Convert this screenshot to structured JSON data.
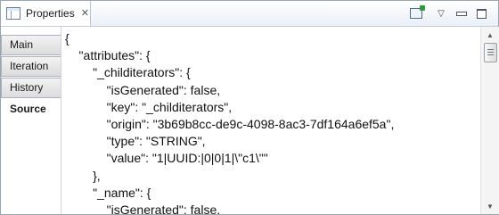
{
  "view": {
    "title": "Properties",
    "tab_icon": "properties-icon",
    "close_icon": "close-icon",
    "toolbar": {
      "pin_icon": "pin-view-icon",
      "menu_icon": "view-menu-chevron-icon",
      "minimize_icon": "minimize-icon",
      "maximize_icon": "maximize-icon",
      "menu_glyph": "▽"
    }
  },
  "sidebar": {
    "tabs": [
      {
        "label": "Main"
      },
      {
        "label": "Iteration"
      },
      {
        "label": "History"
      },
      {
        "label": "Source",
        "active": true
      }
    ]
  },
  "source": {
    "lines": [
      "{",
      "    \"attributes\": {",
      "        \"_childiterators\": {",
      "            \"isGenerated\": false,",
      "            \"key\": \"_childiterators\",",
      "            \"origin\": \"3b69b8cc-de9c-4098-8ac3-7df164a6ef5a\",",
      "            \"type\": \"STRING\",",
      "            \"value\": \"1|UUID:|0|0|1|\\\"c1\\\"\"",
      "        },",
      "        \"_name\": {",
      "            \"isGenerated\": false,"
    ]
  },
  "scrollbar": {
    "up_glyph": "▲",
    "down_glyph": "▼"
  }
}
